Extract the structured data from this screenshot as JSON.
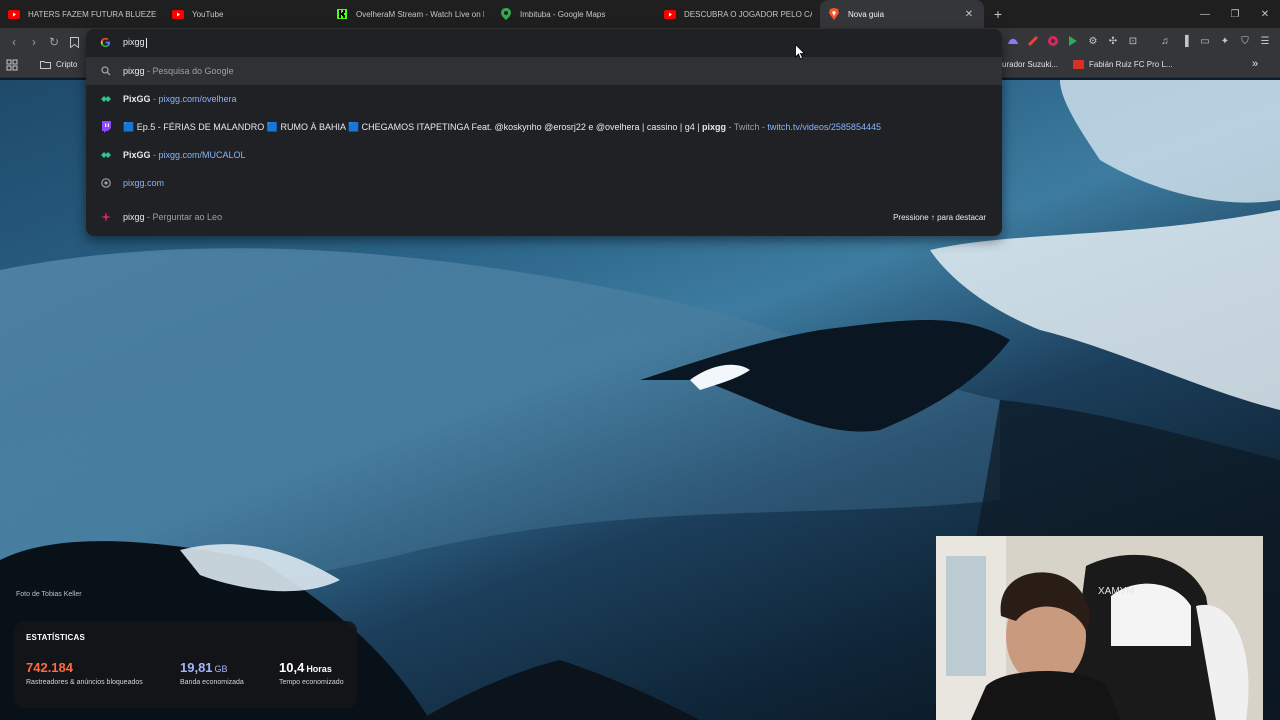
{
  "tabs": [
    {
      "title": "HATERS FAZEM FUTURA BLUEZETE D",
      "icon": "youtube-icon"
    },
    {
      "title": "YouTube",
      "icon": "youtube-icon"
    },
    {
      "title": "OvelheraM Stream - Watch Live on K",
      "icon": "kick-icon"
    },
    {
      "title": "Imbituba - Google Maps",
      "icon": "maps-pin-icon"
    },
    {
      "title": "DESCUBRA O JOGADOR PELO CABEL",
      "icon": "youtube-icon"
    },
    {
      "title": "Nova guia",
      "icon": "brave-icon",
      "active": true
    }
  ],
  "omnibox": {
    "typed": "pixgg",
    "suggestions": [
      {
        "icon": "search-icon",
        "bold": "pixgg",
        "sep": " - ",
        "rest": "Pesquisa do Google",
        "url": ""
      },
      {
        "icon": "pixgg-icon",
        "bold": "PixGG",
        "sep": " - ",
        "rest": "",
        "url": "pixgg.com/ovelhera"
      },
      {
        "icon": "twitch-icon",
        "bold": "",
        "sep": "",
        "rest": "🟦 Ep.5 - FÉRIAS DE MALANDRO 🟦 RUMO À BAHIA 🟦 CHEGAMOS ITAPETINGA Feat. @koskynho @erosrj22 e @ovelhera  |  cassino  |  g4  |  ",
        "bold2": "pixgg",
        "rest2": " - Twitch - ",
        "url": "twitch.tv/videos/2585854445"
      },
      {
        "icon": "pixgg-icon",
        "bold": "PixGG",
        "sep": " - ",
        "rest": "",
        "url": "pixgg.com/MUCALOL"
      },
      {
        "icon": "globe-icon",
        "bold": "",
        "sep": "",
        "rest": "",
        "url": "pixgg.com"
      },
      {
        "icon": "leo-icon",
        "bold": "pixgg",
        "sep": " - ",
        "rest": "Perguntar ao Leo",
        "url": "",
        "hint": "Pressione ↑ para destacar"
      }
    ]
  },
  "bookmarks": {
    "folder": "Cripto",
    "right_items": [
      "urador Suzuki...",
      "Fabián Ruiz FC Pro L..."
    ],
    "overflow": "»"
  },
  "background": {
    "credit": "Foto de Tobias Keller"
  },
  "stats": {
    "heading": "ESTATÍSTICAS",
    "items": [
      {
        "value": "742.184",
        "unit": "",
        "label": "Rastreadores & anúncios bloqueados",
        "color": "#ff6b3d"
      },
      {
        "value": "19,81",
        "unit": "GB",
        "label": "Banda economizada",
        "color": "#a5b4fc"
      },
      {
        "value": "10,4",
        "unit": "Horas",
        "label": "Tempo economizado",
        "color": "#ffffff"
      }
    ]
  },
  "webcam": {
    "overlay_text": "XAMYM"
  }
}
